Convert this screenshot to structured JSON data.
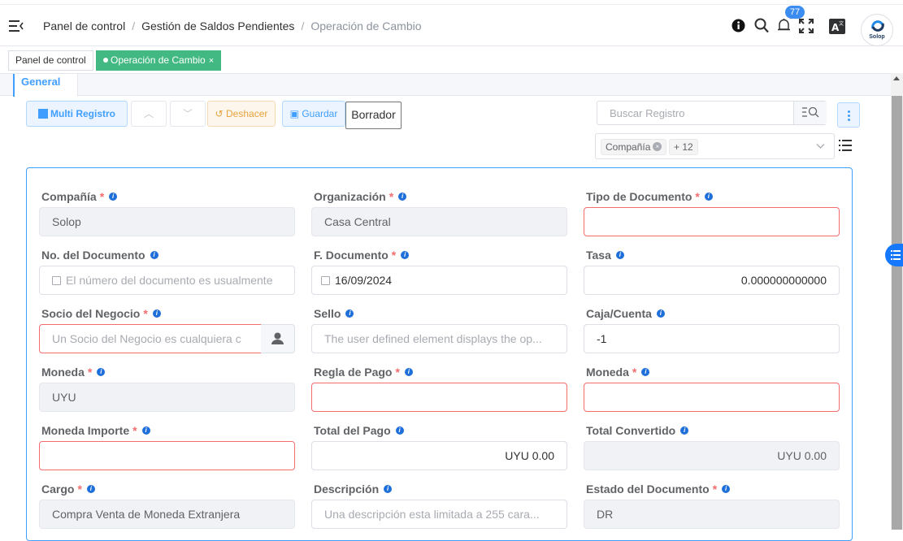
{
  "breadcrumb": {
    "items": [
      "Panel de control",
      "Gestión de Saldos Pendientes"
    ],
    "current": "Operación de Cambio"
  },
  "header": {
    "notification_count": "77",
    "avatar_label": "Solop",
    "icons": [
      "info-icon",
      "search-icon",
      "bell-icon",
      "fullscreen-icon",
      "language-icon"
    ]
  },
  "tags": {
    "dashboard": "Panel de control",
    "active": "Operación de Cambio",
    "close": "×"
  },
  "tabs": {
    "general": "General"
  },
  "toolbar": {
    "multi": "Multi Registro",
    "undo": "Deshacer",
    "save": "Guardar",
    "draft": "Borrador",
    "search_placeholder": "Buscar Registro",
    "filter_chip": "Compañía",
    "filter_more": "+ 12"
  },
  "form": {
    "company": {
      "label": "Compañía",
      "value": "Solop",
      "required": "*"
    },
    "organization": {
      "label": "Organización",
      "value": "Casa Central",
      "required": "*"
    },
    "doc_type": {
      "label": "Tipo de Documento",
      "value": "",
      "required": "*"
    },
    "doc_no": {
      "label": "No. del Documento",
      "placeholder": "El número del documento es usualmente"
    },
    "doc_date": {
      "label": "F. Documento",
      "value": "16/09/2024",
      "required": "*"
    },
    "rate": {
      "label": "Tasa",
      "value": "0.000000000000"
    },
    "bpartner": {
      "label": "Socio del Negocio",
      "placeholder": "Un Socio del Negocio es cualquiera c",
      "required": "*"
    },
    "stamp": {
      "label": "Sello",
      "placeholder": "The user defined element displays the op..."
    },
    "cash_account": {
      "label": "Caja/Cuenta",
      "value": "-1"
    },
    "currency": {
      "label": "Moneda",
      "value": "UYU",
      "required": "*"
    },
    "payment_rule": {
      "label": "Regla de Pago",
      "value": "",
      "required": "*"
    },
    "currency2": {
      "label": "Moneda",
      "value": "",
      "required": "*"
    },
    "amount_currency": {
      "label": "Moneda Importe",
      "value": "",
      "required": "*"
    },
    "total_payment": {
      "label": "Total del Pago",
      "value": "UYU 0.00"
    },
    "total_converted": {
      "label": "Total Convertido",
      "value": "UYU 0.00"
    },
    "charge": {
      "label": "Cargo",
      "value": "Compra Venta de Moneda Extranjera",
      "required": "*"
    },
    "description": {
      "label": "Descripción",
      "placeholder": "Una descripción esta limitada a 255 cara..."
    },
    "doc_status": {
      "label": "Estado del Documento",
      "value": "DR",
      "required": "*"
    }
  },
  "colors": {
    "primary": "#409eff",
    "danger": "#f56c6c",
    "warning": "#e6a23c",
    "success": "#42b983"
  }
}
